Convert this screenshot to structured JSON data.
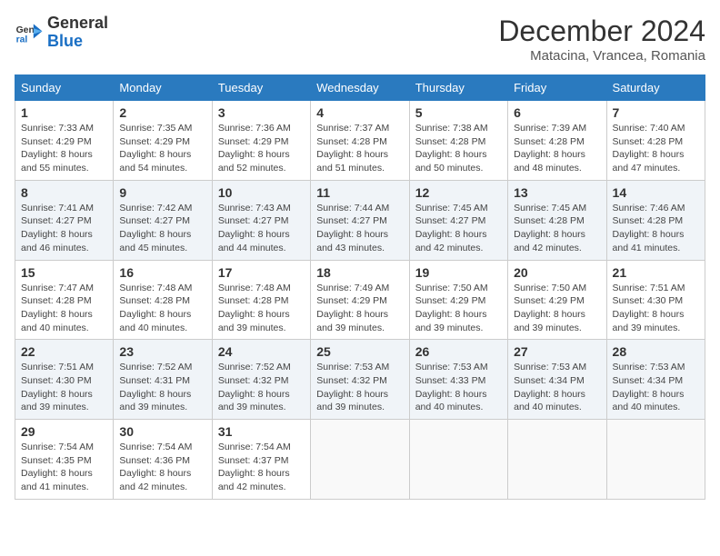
{
  "logo": {
    "general": "General",
    "blue": "Blue"
  },
  "header": {
    "month": "December 2024",
    "location": "Matacina, Vrancea, Romania"
  },
  "weekdays": [
    "Sunday",
    "Monday",
    "Tuesday",
    "Wednesday",
    "Thursday",
    "Friday",
    "Saturday"
  ],
  "weeks": [
    [
      {
        "day": "1",
        "sunrise": "Sunrise: 7:33 AM",
        "sunset": "Sunset: 4:29 PM",
        "daylight": "Daylight: 8 hours and 55 minutes."
      },
      {
        "day": "2",
        "sunrise": "Sunrise: 7:35 AM",
        "sunset": "Sunset: 4:29 PM",
        "daylight": "Daylight: 8 hours and 54 minutes."
      },
      {
        "day": "3",
        "sunrise": "Sunrise: 7:36 AM",
        "sunset": "Sunset: 4:29 PM",
        "daylight": "Daylight: 8 hours and 52 minutes."
      },
      {
        "day": "4",
        "sunrise": "Sunrise: 7:37 AM",
        "sunset": "Sunset: 4:28 PM",
        "daylight": "Daylight: 8 hours and 51 minutes."
      },
      {
        "day": "5",
        "sunrise": "Sunrise: 7:38 AM",
        "sunset": "Sunset: 4:28 PM",
        "daylight": "Daylight: 8 hours and 50 minutes."
      },
      {
        "day": "6",
        "sunrise": "Sunrise: 7:39 AM",
        "sunset": "Sunset: 4:28 PM",
        "daylight": "Daylight: 8 hours and 48 minutes."
      },
      {
        "day": "7",
        "sunrise": "Sunrise: 7:40 AM",
        "sunset": "Sunset: 4:28 PM",
        "daylight": "Daylight: 8 hours and 47 minutes."
      }
    ],
    [
      {
        "day": "8",
        "sunrise": "Sunrise: 7:41 AM",
        "sunset": "Sunset: 4:27 PM",
        "daylight": "Daylight: 8 hours and 46 minutes."
      },
      {
        "day": "9",
        "sunrise": "Sunrise: 7:42 AM",
        "sunset": "Sunset: 4:27 PM",
        "daylight": "Daylight: 8 hours and 45 minutes."
      },
      {
        "day": "10",
        "sunrise": "Sunrise: 7:43 AM",
        "sunset": "Sunset: 4:27 PM",
        "daylight": "Daylight: 8 hours and 44 minutes."
      },
      {
        "day": "11",
        "sunrise": "Sunrise: 7:44 AM",
        "sunset": "Sunset: 4:27 PM",
        "daylight": "Daylight: 8 hours and 43 minutes."
      },
      {
        "day": "12",
        "sunrise": "Sunrise: 7:45 AM",
        "sunset": "Sunset: 4:27 PM",
        "daylight": "Daylight: 8 hours and 42 minutes."
      },
      {
        "day": "13",
        "sunrise": "Sunrise: 7:45 AM",
        "sunset": "Sunset: 4:28 PM",
        "daylight": "Daylight: 8 hours and 42 minutes."
      },
      {
        "day": "14",
        "sunrise": "Sunrise: 7:46 AM",
        "sunset": "Sunset: 4:28 PM",
        "daylight": "Daylight: 8 hours and 41 minutes."
      }
    ],
    [
      {
        "day": "15",
        "sunrise": "Sunrise: 7:47 AM",
        "sunset": "Sunset: 4:28 PM",
        "daylight": "Daylight: 8 hours and 40 minutes."
      },
      {
        "day": "16",
        "sunrise": "Sunrise: 7:48 AM",
        "sunset": "Sunset: 4:28 PM",
        "daylight": "Daylight: 8 hours and 40 minutes."
      },
      {
        "day": "17",
        "sunrise": "Sunrise: 7:48 AM",
        "sunset": "Sunset: 4:28 PM",
        "daylight": "Daylight: 8 hours and 39 minutes."
      },
      {
        "day": "18",
        "sunrise": "Sunrise: 7:49 AM",
        "sunset": "Sunset: 4:29 PM",
        "daylight": "Daylight: 8 hours and 39 minutes."
      },
      {
        "day": "19",
        "sunrise": "Sunrise: 7:50 AM",
        "sunset": "Sunset: 4:29 PM",
        "daylight": "Daylight: 8 hours and 39 minutes."
      },
      {
        "day": "20",
        "sunrise": "Sunrise: 7:50 AM",
        "sunset": "Sunset: 4:29 PM",
        "daylight": "Daylight: 8 hours and 39 minutes."
      },
      {
        "day": "21",
        "sunrise": "Sunrise: 7:51 AM",
        "sunset": "Sunset: 4:30 PM",
        "daylight": "Daylight: 8 hours and 39 minutes."
      }
    ],
    [
      {
        "day": "22",
        "sunrise": "Sunrise: 7:51 AM",
        "sunset": "Sunset: 4:30 PM",
        "daylight": "Daylight: 8 hours and 39 minutes."
      },
      {
        "day": "23",
        "sunrise": "Sunrise: 7:52 AM",
        "sunset": "Sunset: 4:31 PM",
        "daylight": "Daylight: 8 hours and 39 minutes."
      },
      {
        "day": "24",
        "sunrise": "Sunrise: 7:52 AM",
        "sunset": "Sunset: 4:32 PM",
        "daylight": "Daylight: 8 hours and 39 minutes."
      },
      {
        "day": "25",
        "sunrise": "Sunrise: 7:53 AM",
        "sunset": "Sunset: 4:32 PM",
        "daylight": "Daylight: 8 hours and 39 minutes."
      },
      {
        "day": "26",
        "sunrise": "Sunrise: 7:53 AM",
        "sunset": "Sunset: 4:33 PM",
        "daylight": "Daylight: 8 hours and 40 minutes."
      },
      {
        "day": "27",
        "sunrise": "Sunrise: 7:53 AM",
        "sunset": "Sunset: 4:34 PM",
        "daylight": "Daylight: 8 hours and 40 minutes."
      },
      {
        "day": "28",
        "sunrise": "Sunrise: 7:53 AM",
        "sunset": "Sunset: 4:34 PM",
        "daylight": "Daylight: 8 hours and 40 minutes."
      }
    ],
    [
      {
        "day": "29",
        "sunrise": "Sunrise: 7:54 AM",
        "sunset": "Sunset: 4:35 PM",
        "daylight": "Daylight: 8 hours and 41 minutes."
      },
      {
        "day": "30",
        "sunrise": "Sunrise: 7:54 AM",
        "sunset": "Sunset: 4:36 PM",
        "daylight": "Daylight: 8 hours and 42 minutes."
      },
      {
        "day": "31",
        "sunrise": "Sunrise: 7:54 AM",
        "sunset": "Sunset: 4:37 PM",
        "daylight": "Daylight: 8 hours and 42 minutes."
      },
      null,
      null,
      null,
      null
    ]
  ]
}
